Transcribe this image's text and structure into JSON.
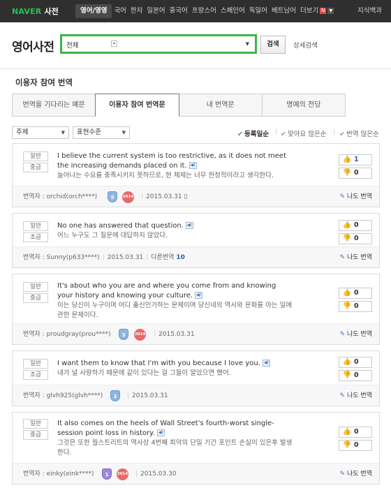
{
  "header": {
    "brand": "NAVER",
    "brand_sub": "사전",
    "nav": [
      {
        "label": "영어/영영",
        "active": true
      },
      {
        "label": "국어"
      },
      {
        "label": "한자"
      },
      {
        "label": "일본어"
      },
      {
        "label": "중국어"
      },
      {
        "label": "프랑스어"
      },
      {
        "label": "스페인어"
      },
      {
        "label": "독일어"
      },
      {
        "label": "베트남어"
      },
      {
        "label": "더보기"
      }
    ],
    "more_badge": "N",
    "right_link": "지식백과"
  },
  "search": {
    "page_title": "영어사전",
    "scope_value": "전체",
    "input_value": "",
    "button_label": "검색",
    "advanced_link": "상세검색"
  },
  "section": {
    "title": "이용자 참여 번역",
    "tabs": [
      "번역을 기다리는 예문",
      "이용자 참여 번역문",
      "내 번역문",
      "명예의 전당"
    ],
    "active_tab": 1
  },
  "filters": {
    "subject": "주제",
    "level": "표현수준",
    "sorts": [
      {
        "label": "등록일순",
        "active": true
      },
      {
        "label": "맞아요 많은순"
      },
      {
        "label": "번역 많은순"
      }
    ]
  },
  "entries": [
    {
      "category": "일반",
      "level": "중급",
      "en": "I believe the current system is too restrictive, as it does not meet the increasing demands placed on it.",
      "ko": "늘어나는 수요를 충족시키지 못하므로, 현 체제는 너무 한정적이라고 생각한다.",
      "up": "1",
      "down": "0",
      "translator_label": "번역자 : ",
      "translator": "orchid(orch****)",
      "grade": "5",
      "extra_badge": "2014",
      "date": "2015.03.31",
      "other_label": "",
      "other_count": "",
      "me_too": "나도 번역"
    },
    {
      "category": "일반",
      "level": "초급",
      "en": "No one has answered that question.",
      "ko": "어느 누구도 그 질문에 대답하지 않았다.",
      "up": "0",
      "down": "0",
      "translator_label": "번역자 : ",
      "translator": "Sunny(p633****)",
      "grade": "",
      "extra_badge": "",
      "date": "2015.03.31",
      "other_label": "다른번역",
      "other_count": "10",
      "me_too": "나도 번역"
    },
    {
      "category": "일반",
      "level": "중급",
      "en": "It's about who you are and where you come from and knowing your history and knowing your culture.",
      "ko": "이는 당신이 누구이며 어디 출신인가하는 문제이며 당신네의 역사와 문화를 아는 일에 관한 문제이다.",
      "up": "0",
      "down": "0",
      "translator_label": "번역자 : ",
      "translator": "proudgray(prou****)",
      "grade": "3",
      "extra_badge": "2014",
      "date": "2015.03.31",
      "other_label": "",
      "other_count": "",
      "me_too": "나도 번역"
    },
    {
      "category": "일반",
      "level": "초급",
      "en": "I want them to know that I'm with you because I love you.",
      "ko": "내가 널 사랑하기 때문에 같이 있다는 걸 그들이 알았으면 했어.",
      "up": "0",
      "down": "0",
      "translator_label": "번역자 : ",
      "translator": "glvh925(glvh****)",
      "grade": "2",
      "extra_badge": "",
      "date": "2015.03.31",
      "other_label": "",
      "other_count": "",
      "me_too": "나도 번역"
    },
    {
      "category": "일반",
      "level": "중급",
      "en": "It also comes on the heels of Wall Street's fourth-worst single-session point loss in history.",
      "ko": "그것은 또한 월스트리트의 역사상 4번째 최악의 단일 기간 포인트 손실이 있은후 발생한다.",
      "up": "0",
      "down": "0",
      "translator_label": "번역자 : ",
      "translator": "einky(eink****)",
      "grade": "1",
      "extra_badge": "2014",
      "date": "2015.03.30",
      "other_label": "",
      "other_count": "",
      "me_too": "나도 번역"
    }
  ],
  "icons": {
    "speaker": "speaker-icon",
    "thumb_up": "thumbs-up-icon",
    "thumb_down": "thumbs-down-icon",
    "pen": "pencil-icon",
    "check": "check-icon"
  },
  "colors": {
    "brand_green": "#29c153",
    "search_border": "#3bb54a",
    "link_blue": "#1d5fb3",
    "topbar": "#2f2f2f"
  }
}
